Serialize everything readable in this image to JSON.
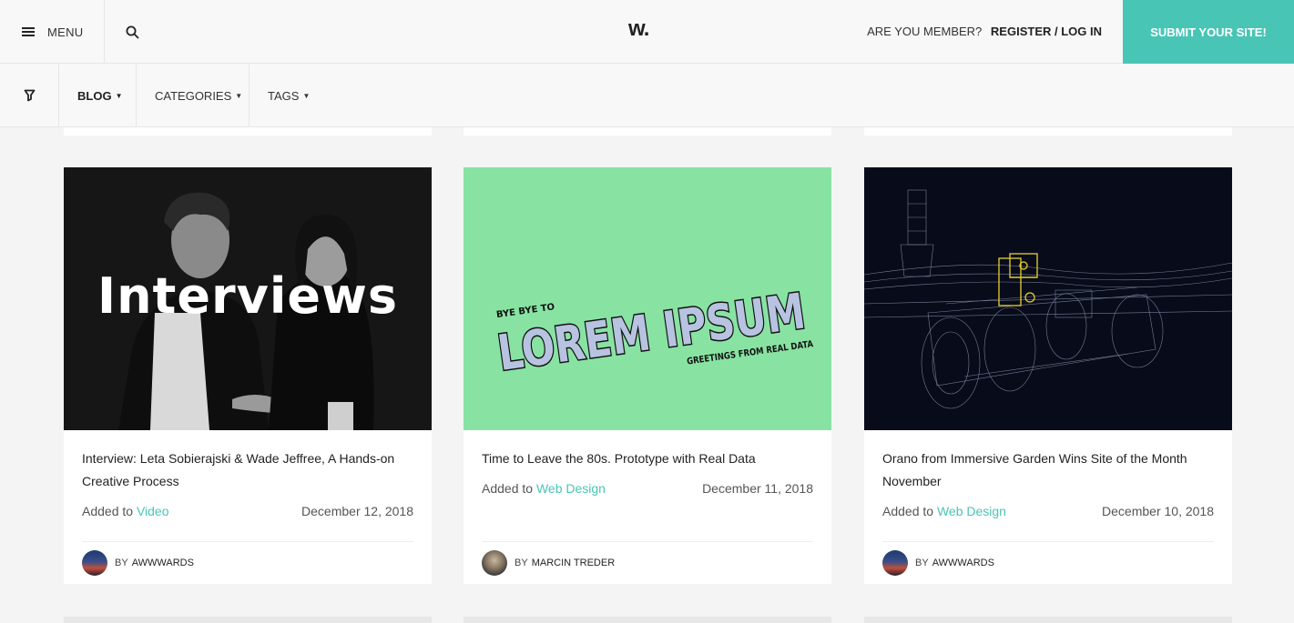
{
  "header": {
    "menu_label": "MENU",
    "logo": "w.",
    "member_question": "ARE YOU MEMBER?",
    "register_label": "REGISTER / LOG IN",
    "submit_label": "SUBMIT YOUR SITE!",
    "accent": "#49c5b6"
  },
  "subnav": {
    "items": [
      {
        "label": "BLOG",
        "active": true
      },
      {
        "label": "CATEGORIES",
        "active": false
      },
      {
        "label": "TAGS",
        "active": false
      }
    ]
  },
  "cards": [
    {
      "thumb_text": "Interviews",
      "title": "Interview: Leta Sobierajski & Wade Jeffree, A Hands-on Creative Process",
      "added_to": "Added to",
      "category": "Video",
      "date": "December 12, 2018",
      "by": "BY",
      "author": "AWWWARDS"
    },
    {
      "thumb_small_top": "BYE BYE TO",
      "thumb_big": "LOREM IPSUM",
      "thumb_small_bottom": "GREETINGS FROM REAL DATA",
      "title": "Time to Leave the 80s. Prototype with Real Data",
      "added_to": "Added to",
      "category": "Web Design",
      "date": "December 11, 2018",
      "by": "BY",
      "author": "MARCIN TREDER"
    },
    {
      "title": "Orano from Immersive Garden Wins Site of the Month November",
      "added_to": "Added to",
      "category": "Web Design",
      "date": "December 10, 2018",
      "by": "BY",
      "author": "AWWWARDS"
    }
  ]
}
